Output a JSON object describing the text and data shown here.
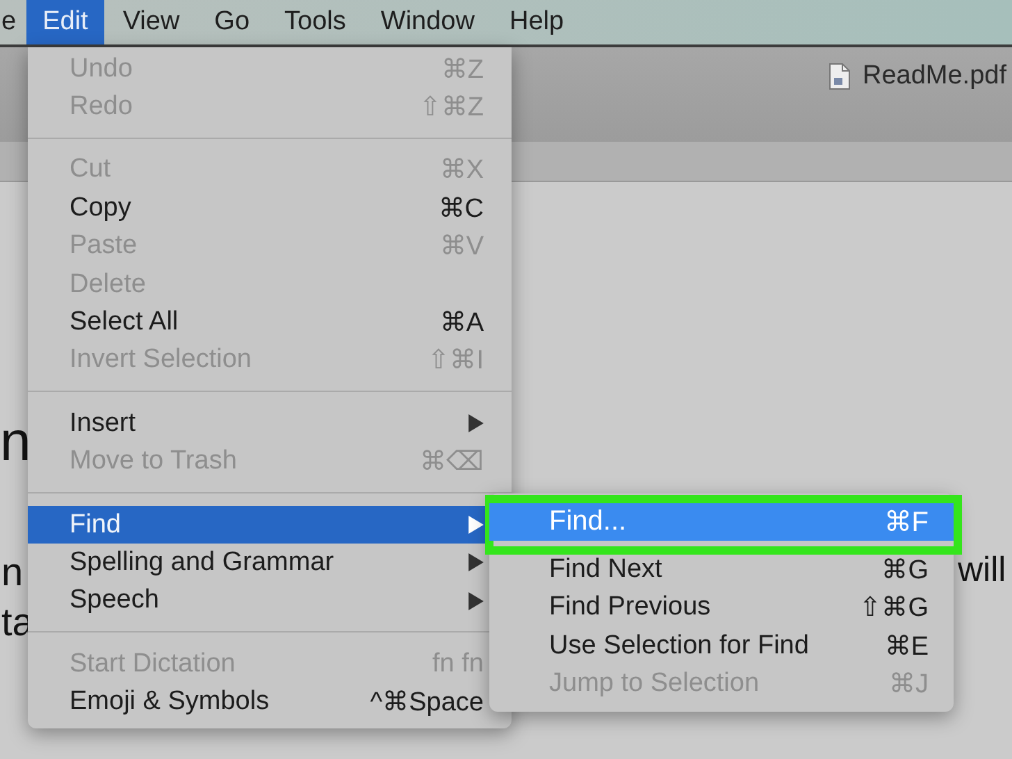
{
  "menu_bar": {
    "items": [
      {
        "label": "e",
        "selected": false
      },
      {
        "label": "Edit",
        "selected": true
      },
      {
        "label": "View",
        "selected": false
      },
      {
        "label": "Go",
        "selected": false
      },
      {
        "label": "Tools",
        "selected": false
      },
      {
        "label": "Window",
        "selected": false
      },
      {
        "label": "Help",
        "selected": false
      }
    ]
  },
  "window": {
    "title": "ReadMe.pdf"
  },
  "document": {
    "heading": "n",
    "line_starts": [
      "n",
      "ta"
    ],
    "line_end": "will"
  },
  "edit_menu": {
    "items": [
      {
        "kind": "item",
        "label": "Undo",
        "shortcut": "⌘Z",
        "disabled": true,
        "has_submenu": false,
        "selected": false
      },
      {
        "kind": "item",
        "label": "Redo",
        "shortcut": "⇧⌘Z",
        "disabled": true,
        "has_submenu": false,
        "selected": false
      },
      {
        "kind": "separator"
      },
      {
        "kind": "item",
        "label": "Cut",
        "shortcut": "⌘X",
        "disabled": true,
        "has_submenu": false,
        "selected": false
      },
      {
        "kind": "item",
        "label": "Copy",
        "shortcut": "⌘C",
        "disabled": false,
        "has_submenu": false,
        "selected": false
      },
      {
        "kind": "item",
        "label": "Paste",
        "shortcut": "⌘V",
        "disabled": true,
        "has_submenu": false,
        "selected": false
      },
      {
        "kind": "item",
        "label": "Delete",
        "disabled": true,
        "has_submenu": false,
        "selected": false
      },
      {
        "kind": "item",
        "label": "Select All",
        "shortcut": "⌘A",
        "disabled": false,
        "has_submenu": false,
        "selected": false
      },
      {
        "kind": "item",
        "label": "Invert Selection",
        "shortcut": "⇧⌘I",
        "disabled": true,
        "has_submenu": false,
        "selected": false
      },
      {
        "kind": "separator"
      },
      {
        "kind": "item",
        "label": "Insert",
        "disabled": false,
        "has_submenu": true,
        "selected": false
      },
      {
        "kind": "item",
        "label": "Move to Trash",
        "shortcut": "⌘⌫",
        "disabled": true,
        "has_submenu": false,
        "selected": false
      },
      {
        "kind": "separator"
      },
      {
        "kind": "item",
        "label": "Find",
        "disabled": false,
        "has_submenu": true,
        "selected": true
      },
      {
        "kind": "item",
        "label": "Spelling and Grammar",
        "disabled": false,
        "has_submenu": true,
        "selected": false
      },
      {
        "kind": "item",
        "label": "Speech",
        "disabled": false,
        "has_submenu": true,
        "selected": false
      },
      {
        "kind": "separator"
      },
      {
        "kind": "item",
        "label": "Start Dictation",
        "shortcut": "fn fn",
        "disabled": true,
        "has_submenu": false,
        "selected": false
      },
      {
        "kind": "item",
        "label": "Emoji & Symbols",
        "shortcut": "^⌘Space",
        "disabled": false,
        "has_submenu": false,
        "selected": false
      }
    ]
  },
  "find_submenu": {
    "items": [
      {
        "label": "Find...",
        "shortcut": "⌘F",
        "disabled": false,
        "selected": true,
        "highlighted": true
      },
      {
        "label": "Find Next",
        "shortcut": "⌘G",
        "disabled": false,
        "selected": false,
        "highlighted": false
      },
      {
        "label": "Find Previous",
        "shortcut": "⇧⌘G",
        "disabled": false,
        "selected": false,
        "highlighted": false
      },
      {
        "label": "Use Selection for Find",
        "shortcut": "⌘E",
        "disabled": false,
        "selected": false,
        "highlighted": false
      },
      {
        "label": "Jump to Selection",
        "shortcut": "⌘J",
        "disabled": true,
        "selected": false,
        "highlighted": false
      }
    ]
  }
}
